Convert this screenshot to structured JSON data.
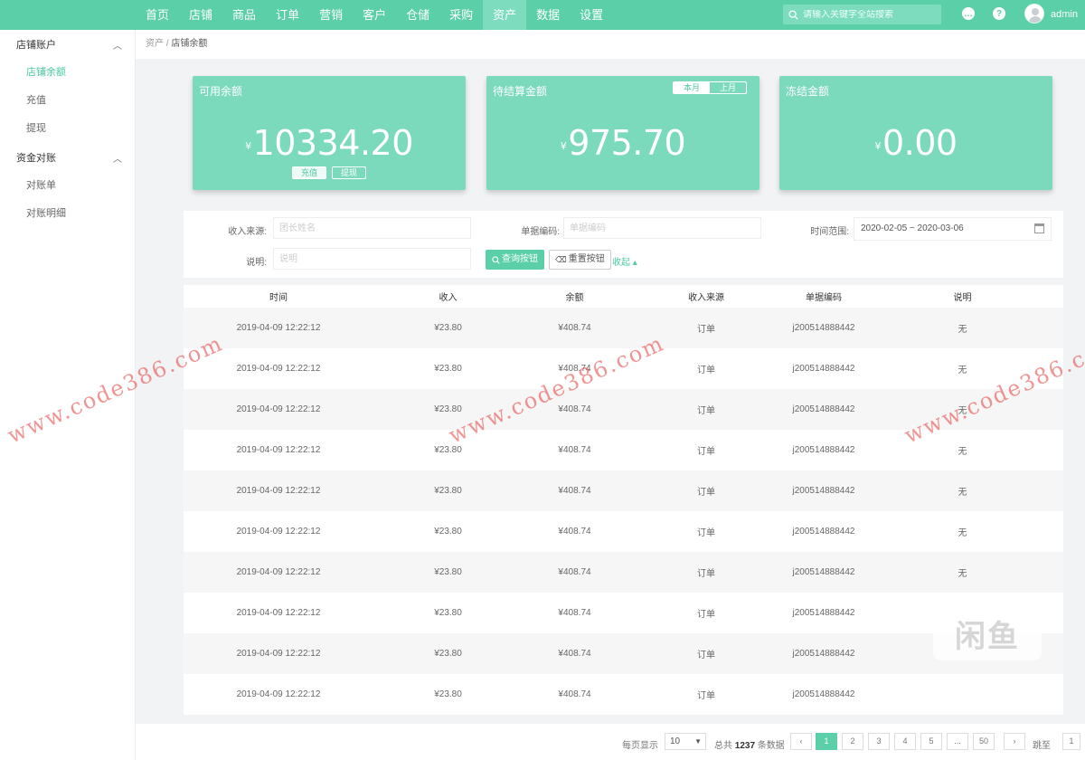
{
  "nav": {
    "items": [
      "首页",
      "店铺",
      "商品",
      "订单",
      "营销",
      "客户",
      "仓储",
      "采购",
      "资产",
      "数据",
      "设置"
    ],
    "active_index": 8,
    "search_placeholder": "请输入关键字全站搜索",
    "username": "admin"
  },
  "sidebar": {
    "groups": [
      {
        "label": "店铺账户",
        "items": [
          "店铺余额",
          "充值",
          "提现"
        ]
      },
      {
        "label": "资金对账",
        "items": [
          "对账单",
          "对账明细"
        ]
      }
    ],
    "active_item": "店铺余额"
  },
  "breadcrumb": {
    "parent": "资产",
    "separator": "/",
    "current": "店铺余额"
  },
  "cards": {
    "available": {
      "title": "可用余额",
      "currency": "¥",
      "amount": "10334.20",
      "recharge": "充值",
      "withdraw": "提现"
    },
    "pending": {
      "title": "待结算金额",
      "currency": "¥",
      "amount": "975.70",
      "toggle": [
        "本月",
        "上月"
      ],
      "toggle_active": 0
    },
    "frozen": {
      "title": "冻结金额",
      "currency": "¥",
      "amount": "0.00"
    }
  },
  "filter": {
    "source_label": "收入来源:",
    "source_placeholder": "团长姓名",
    "code_label": "单据编码:",
    "code_placeholder": "单据编码",
    "time_label": "时间范围:",
    "time_value": "2020-02-05 ~ 2020-03-06",
    "note_label": "说明:",
    "note_placeholder": "说明",
    "query_button": "查询按钮",
    "reset_button": "重置按钮",
    "collapse_link": "收起"
  },
  "table": {
    "columns": [
      "时间",
      "收入",
      "余额",
      "收入来源",
      "单据编码",
      "说明"
    ],
    "rows": [
      [
        "2019-04-09 12:22:12",
        "¥23.80",
        "¥408.74",
        "订单",
        "j200514888442",
        "无"
      ],
      [
        "2019-04-09 12:22:12",
        "¥23.80",
        "¥408.74",
        "订单",
        "j200514888442",
        "无"
      ],
      [
        "2019-04-09 12:22:12",
        "¥23.80",
        "¥408.74",
        "订单",
        "j200514888442",
        "无"
      ],
      [
        "2019-04-09 12:22:12",
        "¥23.80",
        "¥408.74",
        "订单",
        "j200514888442",
        "无"
      ],
      [
        "2019-04-09 12:22:12",
        "¥23.80",
        "¥408.74",
        "订单",
        "j200514888442",
        "无"
      ],
      [
        "2019-04-09 12:22:12",
        "¥23.80",
        "¥408.74",
        "订单",
        "j200514888442",
        "无"
      ],
      [
        "2019-04-09 12:22:12",
        "¥23.80",
        "¥408.74",
        "订单",
        "j200514888442",
        "无"
      ],
      [
        "2019-04-09 12:22:12",
        "¥23.80",
        "¥408.74",
        "订单",
        "j200514888442",
        ""
      ],
      [
        "2019-04-09 12:22:12",
        "¥23.80",
        "¥408.74",
        "订单",
        "j200514888442",
        ""
      ],
      [
        "2019-04-09 12:22:12",
        "¥23.80",
        "¥408.74",
        "订单",
        "j200514888442",
        ""
      ]
    ]
  },
  "pagination": {
    "page_size_label": "每页显示",
    "page_size": "10",
    "total_prefix": "总共",
    "total": "1237",
    "total_suffix": "条数据",
    "prev": "‹",
    "pages": [
      "1",
      "2",
      "3",
      "4",
      "5",
      "...",
      "50"
    ],
    "current_page": "1",
    "next": "›",
    "jump_label": "跳至",
    "jump_value": "1"
  },
  "watermarks": {
    "text": "www.code386.com",
    "logo": "闲鱼"
  },
  "colors": {
    "brand": "#5bcfa7",
    "card": "#7bd9bc",
    "accent_text": "#4ccaa0"
  }
}
